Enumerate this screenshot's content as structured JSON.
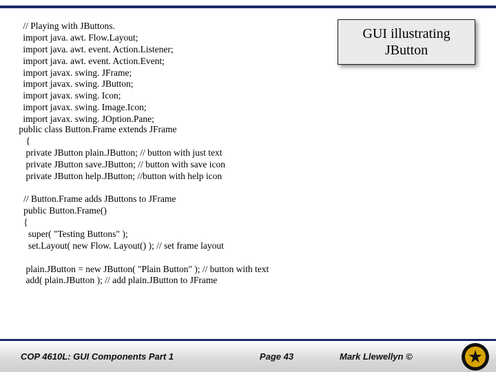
{
  "title_box": {
    "line1": "GUI illustrating",
    "line2": "JButton"
  },
  "code": {
    "imports": " // Playing with JButtons.\n import java. awt. Flow.Layout;\n import java. awt. event. Action.Listener;\n import java. awt. event. Action.Event;\n import javax. swing. JFrame;\n import javax. swing. JButton;\n import javax. swing. Icon;\n import javax. swing. Image.Icon;\n import javax. swing. JOption.Pane;",
    "body": " public class Button.Frame extends JFrame\n    {\n    private JButton plain.JButton; // button with just text\n    private JButton save.JButton; // button with save icon\n    private JButton help.JButton; //button with help icon\n\n   // Button.Frame adds JButtons to JFrame\n   public Button.Frame()\n   {\n     super( \"Testing Buttons\" );\n     set.Layout( new Flow. Layout() ); // set frame layout\n\n    plain.JButton = new JButton( \"Plain Button\" ); // button with text\n    add( plain.JButton ); // add plain.JButton to JFrame"
  },
  "footer": {
    "left": "COP 4610L: GUI Components Part 1",
    "center": "Page 43",
    "right": "Mark Llewellyn ©"
  }
}
